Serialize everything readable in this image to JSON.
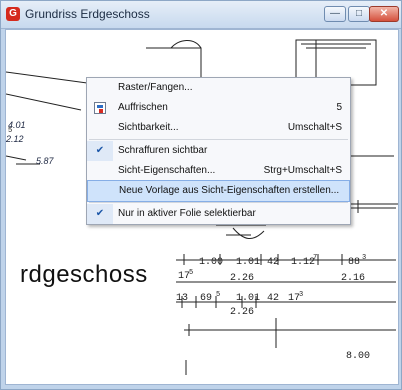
{
  "window": {
    "title": "Grundriss Erdgeschoss",
    "buttons": [
      "minimize",
      "maximize",
      "close"
    ]
  },
  "drawing": {
    "big_label": "rdgeschoss",
    "left_texts": [
      "4.01",
      "2.12",
      "5.87"
    ],
    "superscripts": [
      "5",
      "5",
      "5",
      "7",
      "3",
      "3"
    ],
    "dimension_texts": [
      "1.00",
      "1.01",
      "42",
      "1.12",
      "88",
      "17",
      "2.26",
      "2.16",
      "13",
      "69",
      "1.01",
      "42",
      "17",
      "2.26",
      "8.00"
    ]
  },
  "context_menu": {
    "items": [
      {
        "label": "Raster/Fangen...",
        "shortcut": "",
        "icon": "",
        "checked": false
      },
      {
        "label": "Auffrischen",
        "shortcut": "5",
        "icon": "refresh-icon",
        "checked": false
      },
      {
        "label": "Sichtbarkeit...",
        "shortcut": "Umschalt+S",
        "icon": "",
        "checked": false
      },
      {
        "label": "Schraffuren sichtbar",
        "shortcut": "",
        "icon": "check-icon",
        "checked": true
      },
      {
        "label": "Sicht-Eigenschaften...",
        "shortcut": "Strg+Umschalt+S",
        "icon": "",
        "checked": false
      },
      {
        "label": "Neue Vorlage aus Sicht-Eigenschaften erstellen...",
        "shortcut": "",
        "icon": "",
        "checked": false,
        "selected": true
      },
      {
        "label": "Nur in aktiver Folie selektierbar",
        "shortcut": "",
        "icon": "check-icon",
        "checked": true
      }
    ]
  }
}
